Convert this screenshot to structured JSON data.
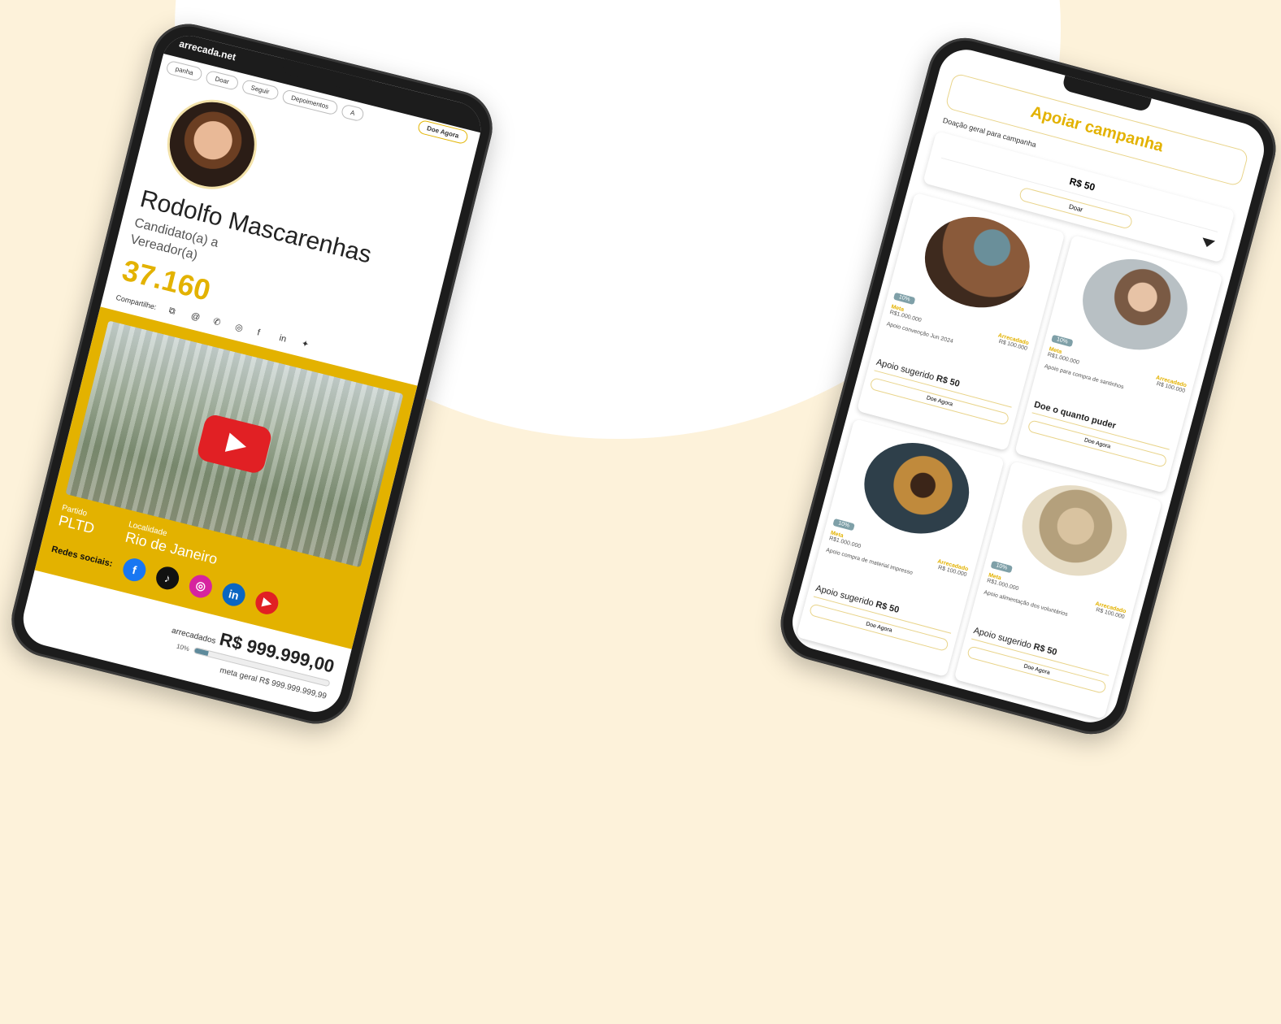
{
  "left_phone": {
    "brand": "arrecada.net",
    "nav": [
      "panha",
      "Doar",
      "Seguir",
      "Depoimentos",
      "A",
      "Doe Agora"
    ],
    "candidate": {
      "name": "Rodolfo Mascarenhas",
      "role": "Candidato(a) a Vereador(a)",
      "number": "37.160"
    },
    "share_label": "Compartilhe:",
    "share_icons": [
      "copy-icon",
      "threads-icon",
      "whatsapp-icon",
      "instagram-icon",
      "facebook-icon",
      "linkedin-icon",
      "twitter-icon"
    ],
    "party_label": "Partido",
    "party_value": "PLTD",
    "location_label": "Localidade",
    "location_value": "Rio de Janeiro",
    "social_label": "Redes sociais:",
    "raised_label": "arrecadados",
    "raised_value": "R$ 999.999,00",
    "progress_label": "10%",
    "progress": 0.1,
    "goal_text": "meta geral R$ 999.999.999,99",
    "colors": {
      "accent": "#e3b200",
      "youtube": "#e12024"
    }
  },
  "right_phone": {
    "title": "Apoiar campanha",
    "general_label": "Doação geral para campanha",
    "general_amount": "R$ 50",
    "general_button": "Doar",
    "cards": [
      {
        "pct": "10%",
        "meta_label": "Meta",
        "meta_value": "R$1.000.000",
        "raised_label": "Arrecadado",
        "raised_value": "R$ 100.000",
        "desc": "Apoio convenção Jun 2024",
        "cta_text": "Apoio sugerido",
        "cta_amount": "R$ 50",
        "button": "Doe Agora"
      },
      {
        "pct": "10%",
        "meta_label": "Meta",
        "meta_value": "R$1.000.000",
        "raised_label": "Arrecadado",
        "raised_value": "R$ 100.000",
        "desc": "Apoio para compra de santinhos",
        "cta_text": "Doe o quanto puder",
        "cta_amount": "",
        "button": "Doe Agora"
      },
      {
        "pct": "10%",
        "meta_label": "Meta",
        "meta_value": "R$1.000.000",
        "raised_label": "Arrecadado",
        "raised_value": "R$ 100.000",
        "desc": "Apoio compra de material impresso",
        "cta_text": "Apoio sugerido",
        "cta_amount": "R$ 50",
        "button": "Doe Agora"
      },
      {
        "pct": "10%",
        "meta_label": "Meta",
        "meta_value": "R$1.000.000",
        "raised_label": "Arrecadado",
        "raised_value": "R$ 100.000",
        "desc": "Apoio alimentação dos voluntários",
        "cta_text": "Apoio sugerido",
        "cta_amount": "R$ 50",
        "button": "Doe Agora"
      }
    ]
  }
}
